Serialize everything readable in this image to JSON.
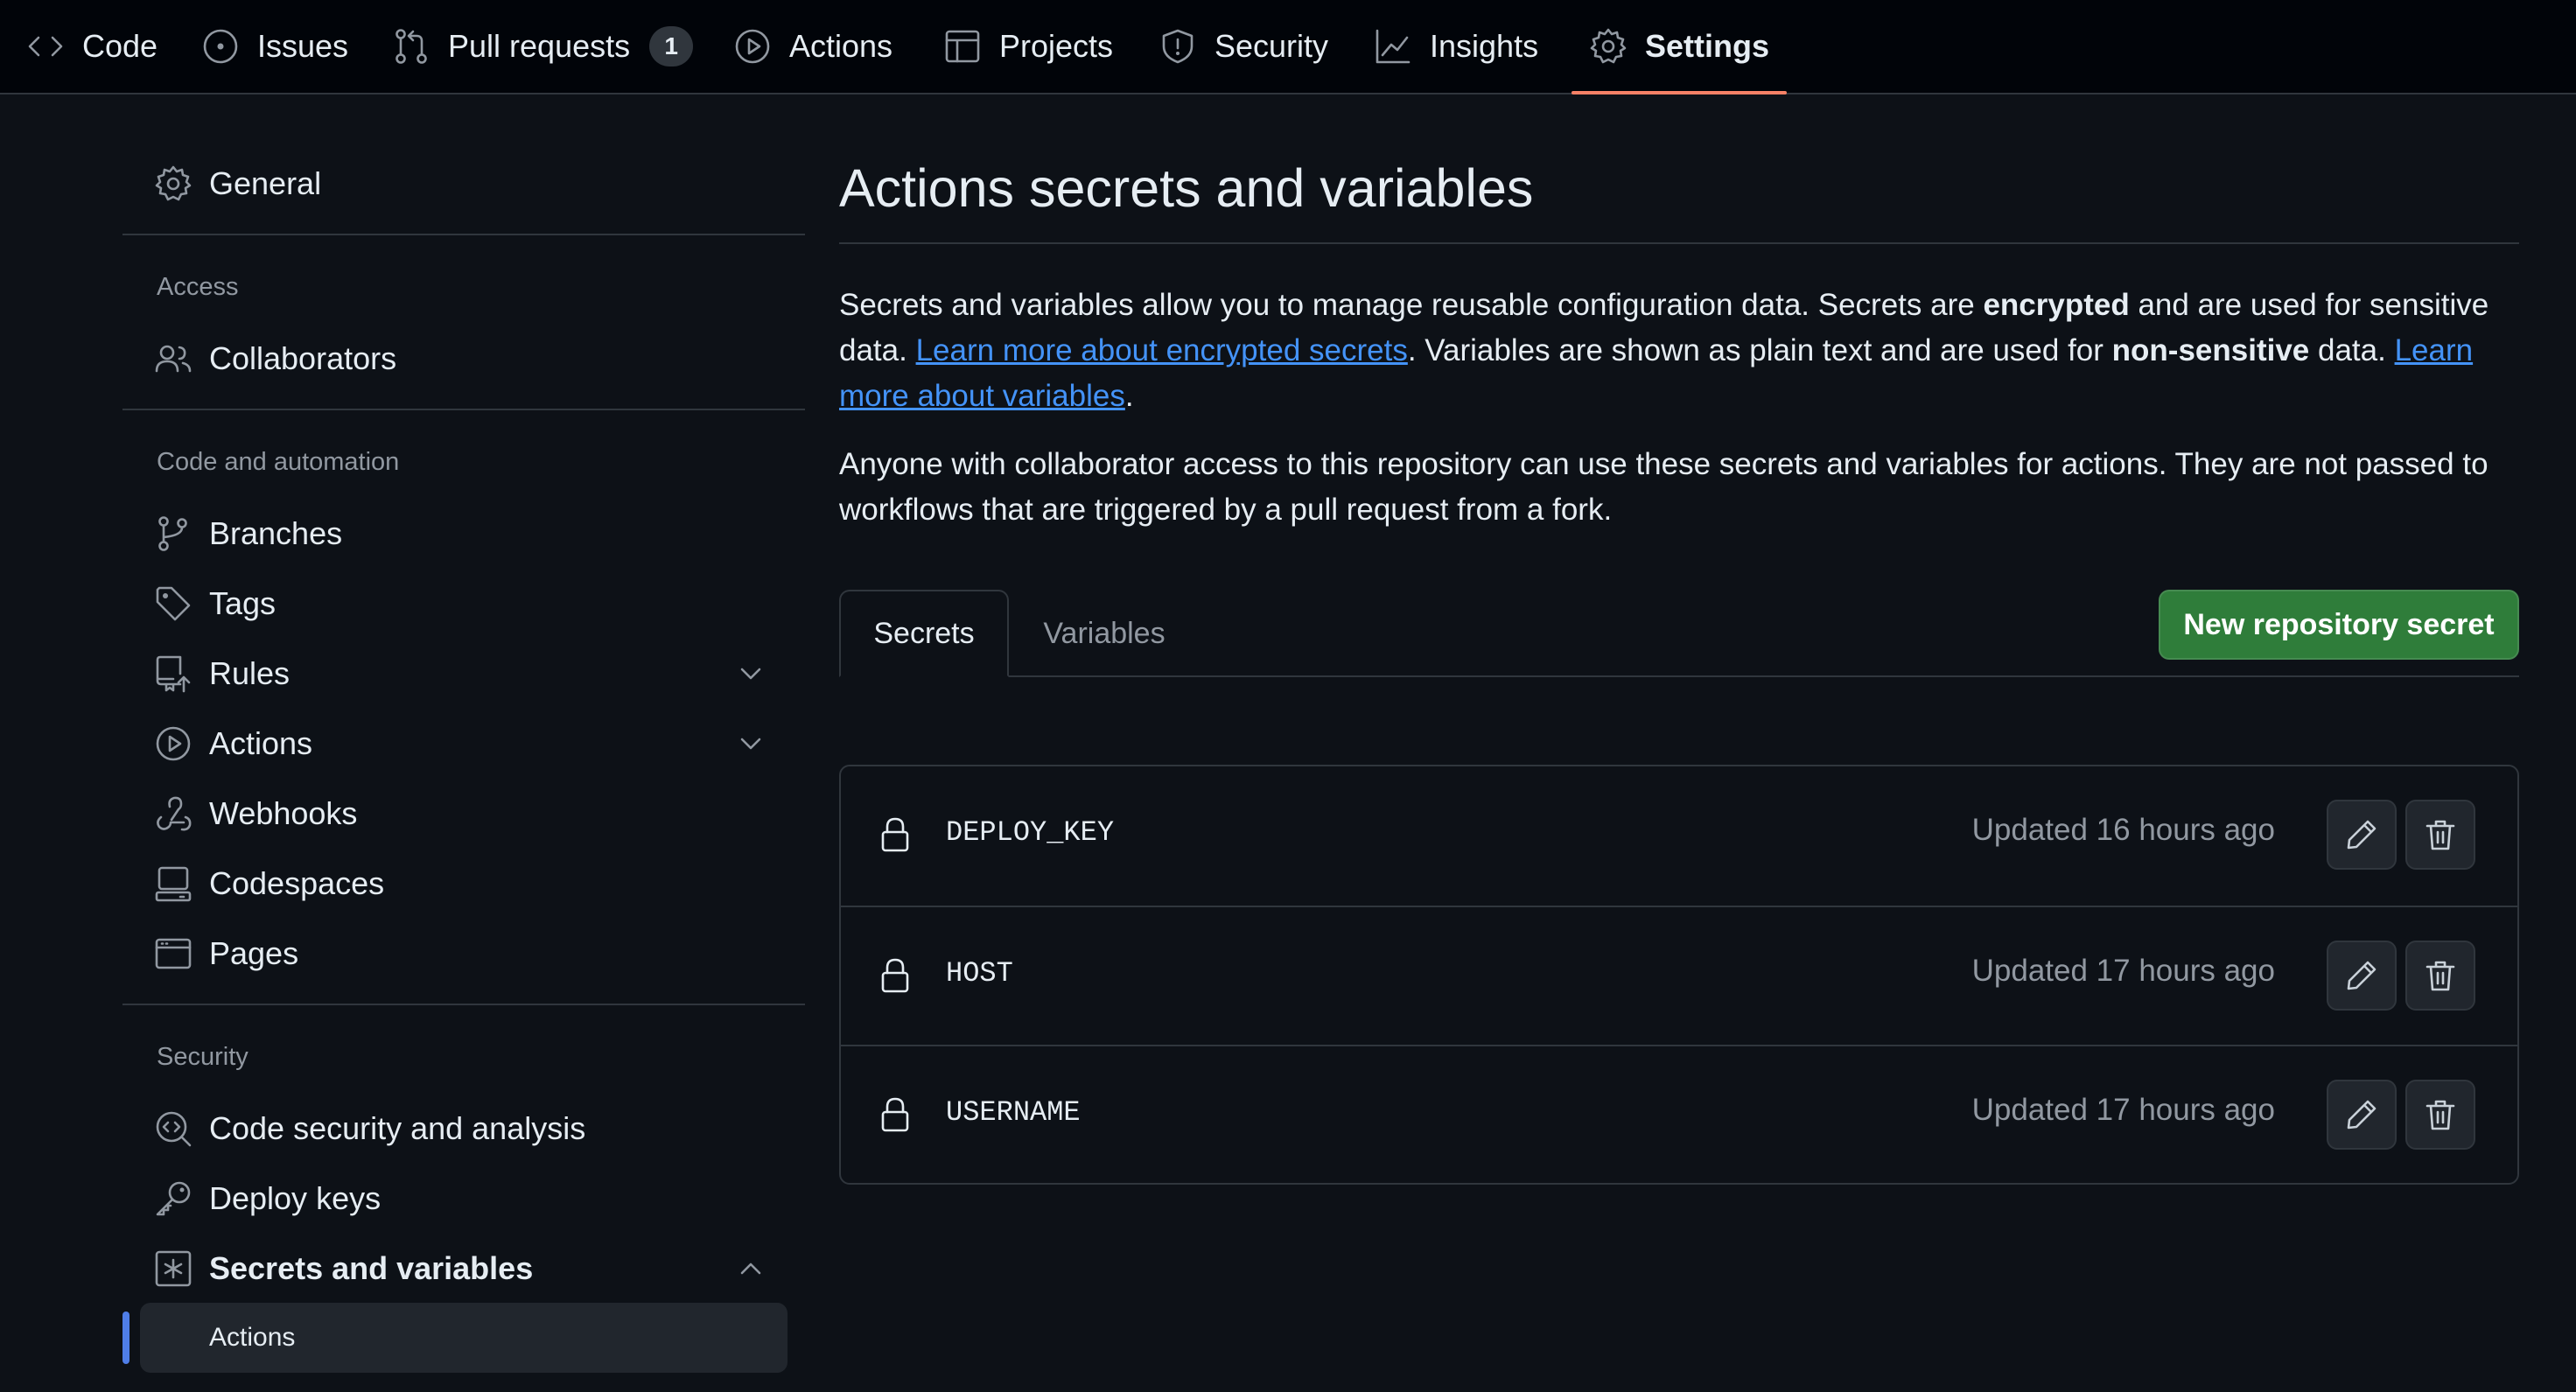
{
  "nav": {
    "tabs": [
      {
        "label": "Code",
        "icon": "code-icon"
      },
      {
        "label": "Issues",
        "icon": "issue-icon"
      },
      {
        "label": "Pull requests",
        "icon": "pull-request-icon",
        "count": "1"
      },
      {
        "label": "Actions",
        "icon": "play-icon"
      },
      {
        "label": "Projects",
        "icon": "table-icon"
      },
      {
        "label": "Security",
        "icon": "shield-icon"
      },
      {
        "label": "Insights",
        "icon": "graph-icon"
      },
      {
        "label": "Settings",
        "icon": "gear-icon",
        "selected": true
      }
    ]
  },
  "sidebar": {
    "general": "General",
    "access_heading": "Access",
    "collaborators": "Collaborators",
    "code_heading": "Code and automation",
    "branches": "Branches",
    "tags": "Tags",
    "rules": "Rules",
    "actions": "Actions",
    "webhooks": "Webhooks",
    "codespaces": "Codespaces",
    "pages": "Pages",
    "security_heading": "Security",
    "code_security": "Code security and analysis",
    "deploy_keys": "Deploy keys",
    "secrets": "Secrets and variables",
    "secrets_sub_actions": "Actions"
  },
  "main": {
    "title": "Actions secrets and variables",
    "intro": {
      "p1_a": "Secrets and variables allow you to manage reusable configuration data. Secrets are ",
      "p1_b": "encrypted",
      "p1_c": " and are used for sensitive data. ",
      "p1_link1": "Learn more about encrypted secrets",
      "p1_d": ". Variables are shown as plain text and are used for ",
      "p1_e": "non-sensitive",
      "p1_f": " data. ",
      "p1_link2": "Learn more about variables",
      "p1_g": ".",
      "p2": "Anyone with collaborator access to this repository can use these secrets and variables for actions. They are not passed to workflows that are triggered by a pull request from a fork."
    },
    "tabs": [
      "Secrets",
      "Variables"
    ],
    "new_button": "New repository secret",
    "secrets": [
      {
        "name": "DEPLOY_KEY",
        "updated": "Updated 16 hours ago"
      },
      {
        "name": "HOST",
        "updated": "Updated 17 hours ago"
      },
      {
        "name": "USERNAME",
        "updated": "Updated 17 hours ago"
      }
    ]
  },
  "colors": {
    "background": "#0d1117",
    "header": "#010409",
    "accent_tab": "#f78166",
    "link": "#4493f8",
    "primary_button": "#2f7d3a",
    "sidebar_marker": "#4f7ee8"
  }
}
